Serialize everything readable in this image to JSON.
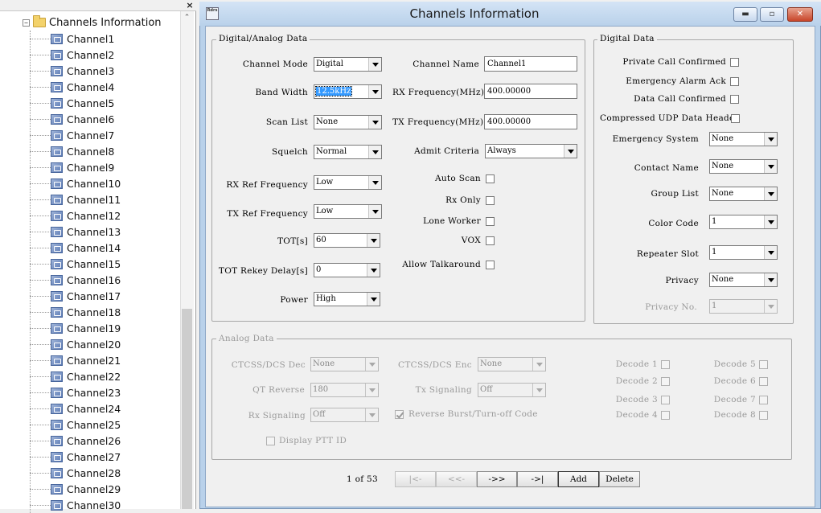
{
  "tree": {
    "root_label": "Channels Information",
    "close_glyph": "×",
    "scroll_up_glyph": "⌃",
    "expander_glyph": "−",
    "channels": [
      "Channel1",
      "Channel2",
      "Channel3",
      "Channel4",
      "Channel5",
      "Channel6",
      "Channel7",
      "Channel8",
      "Channel9",
      "Channel10",
      "Channel11",
      "Channel12",
      "Channel13",
      "Channel14",
      "Channel15",
      "Channel16",
      "Channel17",
      "Channel18",
      "Channel19",
      "Channel20",
      "Channel21",
      "Channel22",
      "Channel23",
      "Channel24",
      "Channel25",
      "Channel26",
      "Channel27",
      "Channel28",
      "Channel29",
      "Channel30"
    ]
  },
  "window": {
    "title": "Channels Information",
    "app_icon_text": "Rdrs",
    "minimize_glyph": "▬",
    "maximize_glyph": "▫",
    "close_glyph": "✕"
  },
  "digital_analog": {
    "group_title": "Digital/Analog Data",
    "channel_mode": {
      "label": "Channel Mode",
      "value": "Digital"
    },
    "band_width": {
      "label": "Band Width",
      "value": "12.5kHz"
    },
    "scan_list": {
      "label": "Scan List",
      "value": "None"
    },
    "squelch": {
      "label": "Squelch",
      "value": "Normal"
    },
    "rx_ref_freq": {
      "label": "RX Ref Frequency",
      "value": "Low"
    },
    "tx_ref_freq": {
      "label": "TX Ref Frequency",
      "value": "Low"
    },
    "tot": {
      "label": "TOT[s]",
      "value": "60"
    },
    "tot_rekey": {
      "label": "TOT Rekey Delay[s]",
      "value": "0"
    },
    "power": {
      "label": "Power",
      "value": "High"
    },
    "channel_name": {
      "label": "Channel Name",
      "value": "Channel1"
    },
    "rx_frequency": {
      "label": "RX Frequency(MHz)",
      "value": "400.00000"
    },
    "tx_frequency": {
      "label": "TX Frequency(MHz)",
      "value": "400.00000"
    },
    "admit_criteria": {
      "label": "Admit Criteria",
      "value": "Always"
    },
    "auto_scan": {
      "label": "Auto Scan",
      "checked": false
    },
    "rx_only": {
      "label": "Rx Only",
      "checked": false
    },
    "lone_worker": {
      "label": "Lone Worker",
      "checked": false
    },
    "vox": {
      "label": "VOX",
      "checked": false
    },
    "allow_talkaround": {
      "label": "Allow Talkaround",
      "checked": false
    }
  },
  "digital": {
    "group_title": "Digital Data",
    "private_call_confirmed": {
      "label": "Private Call Confirmed",
      "checked": false
    },
    "emergency_alarm_ack": {
      "label": "Emergency Alarm Ack",
      "checked": false
    },
    "data_call_confirmed": {
      "label": "Data Call Confirmed",
      "checked": false
    },
    "compressed_udp": {
      "label": "Compressed UDP Data Header",
      "checked": false
    },
    "emergency_system": {
      "label": "Emergency System",
      "value": "None"
    },
    "contact_name": {
      "label": "Contact Name",
      "value": "None"
    },
    "group_list": {
      "label": "Group List",
      "value": "None"
    },
    "color_code": {
      "label": "Color Code",
      "value": "1"
    },
    "repeater_slot": {
      "label": "Repeater Slot",
      "value": "1"
    },
    "privacy": {
      "label": "Privacy",
      "value": "None"
    },
    "privacy_no": {
      "label": "Privacy No.",
      "value": "1"
    }
  },
  "analog": {
    "group_title": "Analog Data",
    "ctcss_dec": {
      "label": "CTCSS/DCS Dec",
      "value": "None"
    },
    "ctcss_enc": {
      "label": "CTCSS/DCS Enc",
      "value": "None"
    },
    "qt_reverse": {
      "label": "QT Reverse",
      "value": "180"
    },
    "tx_signaling": {
      "label": "Tx Signaling",
      "value": "Off"
    },
    "rx_signaling": {
      "label": "Rx Signaling",
      "value": "Off"
    },
    "reverse_burst": {
      "label": "Reverse Burst/Turn-off Code",
      "checked": true
    },
    "display_ptt_id": {
      "label": "Display PTT ID",
      "checked": false
    },
    "decode": [
      "Decode 1",
      "Decode 2",
      "Decode 3",
      "Decode 4",
      "Decode 5",
      "Decode 6",
      "Decode 7",
      "Decode 8"
    ]
  },
  "pager": {
    "page_info": "1 of 53",
    "first": "|<-",
    "prev": "<<-",
    "next": "->>",
    "last": "->|",
    "add": "Add",
    "delete": "Delete"
  }
}
